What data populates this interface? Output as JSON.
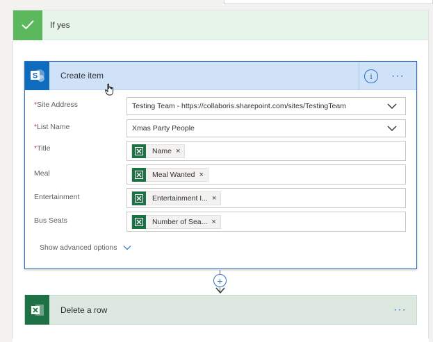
{
  "condition": {
    "title": "If yes",
    "color": "#5cb85c"
  },
  "create_item": {
    "title": "Create item",
    "icon": "sharepoint-icon",
    "info_label": "i",
    "more_label": "···",
    "fields": [
      {
        "label": "Site Address",
        "required": true,
        "type": "dropdown",
        "value": "Testing Team - https://collaboris.sharepoint.com/sites/TestingTeam"
      },
      {
        "label": "List Name",
        "required": true,
        "type": "dropdown",
        "value": "Xmas Party People"
      },
      {
        "label": "Title",
        "required": true,
        "type": "token",
        "value": "Name"
      },
      {
        "label": "Meal",
        "required": false,
        "type": "token",
        "value": "Meal Wanted"
      },
      {
        "label": "Entertainment",
        "required": false,
        "type": "token",
        "value": "Entertainment I..."
      },
      {
        "label": "Bus Seats",
        "required": false,
        "type": "token",
        "value": "Number of Sea..."
      }
    ],
    "advanced_options_label": "Show advanced options",
    "required_marker": "*",
    "token_remove": "×"
  },
  "connector": {
    "plus_label": "+"
  },
  "delete_row": {
    "title": "Delete a row",
    "icon": "excel-icon",
    "more_label": "···"
  },
  "colors": {
    "sharepoint_blue": "#0f6cbd",
    "excel_green": "#1e7145",
    "accent_blue": "#2b6fc2"
  }
}
